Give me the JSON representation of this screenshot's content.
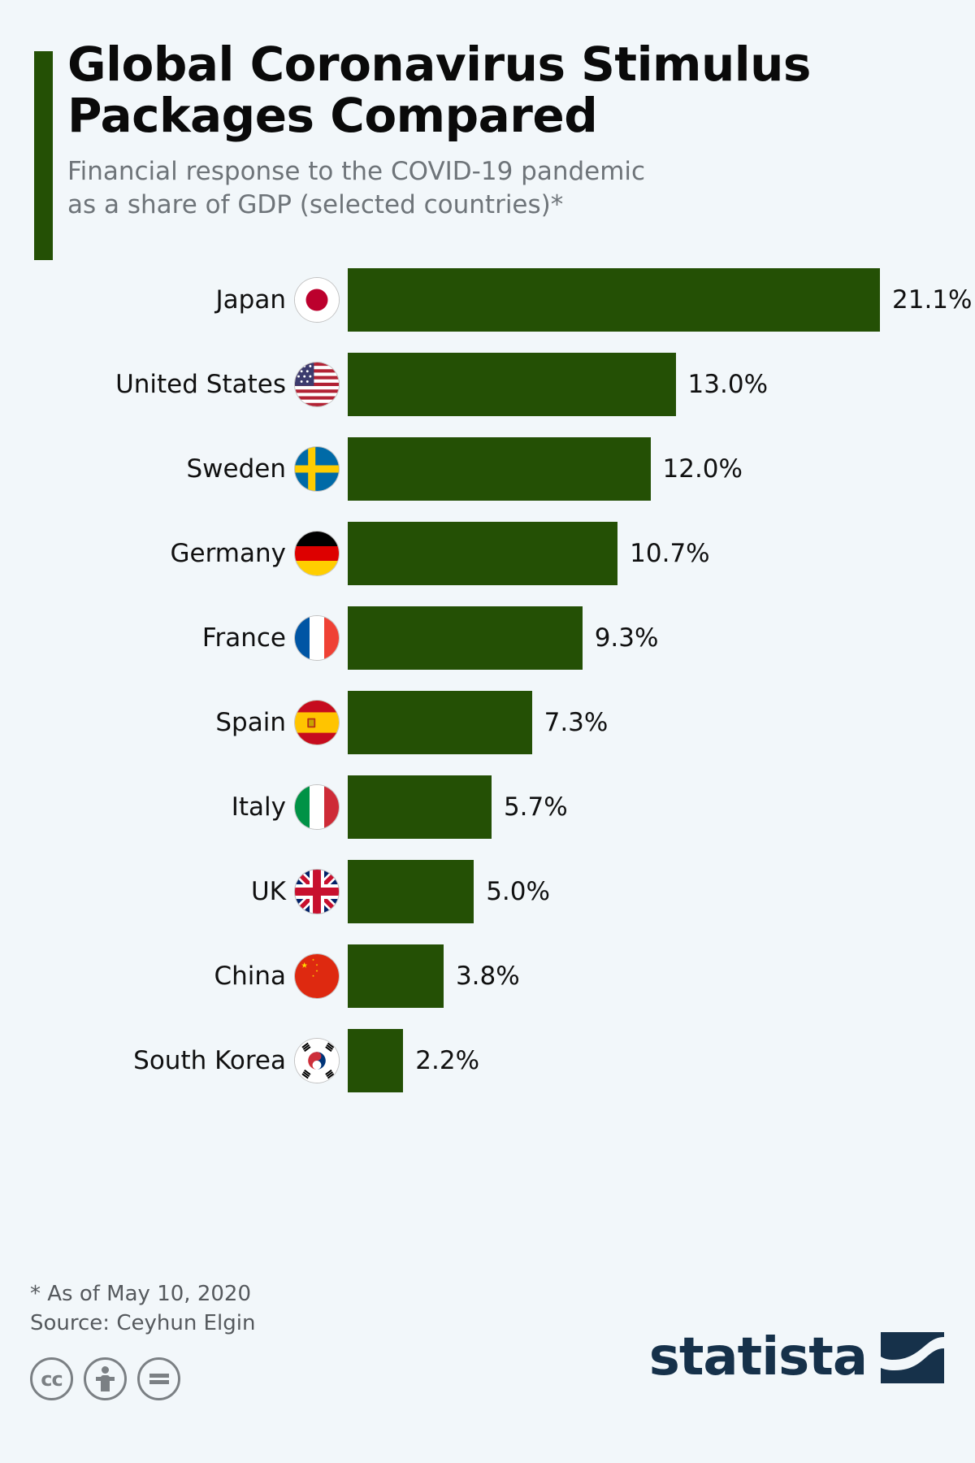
{
  "header": {
    "title": "Global Coronavirus Stimulus Packages Compared",
    "title_line1": "Global Coronavirus Stimulus",
    "title_line2": "Packages Compared",
    "subtitle_line1": "Financial response to the COVID-19 pandemic",
    "subtitle_line2": "as a share of GDP (selected countries)*",
    "accent_color": "#245005"
  },
  "footer": {
    "footnote_line1": "* As of May 10, 2020",
    "footnote_line2": "Source: Ceyhun Elgin",
    "cc_icons": [
      "cc-icon",
      "cc-by-attribution-icon",
      "cc-nd-equals-icon"
    ],
    "cc_label": "cc",
    "brand": "statista",
    "brand_color": "#16314a"
  },
  "chart_data": {
    "type": "bar",
    "orientation": "horizontal",
    "title": "Global Coronavirus Stimulus Packages Compared",
    "subtitle": "Financial response to the COVID-19 pandemic as a share of GDP (selected countries)*",
    "xlabel": "",
    "ylabel": "",
    "unit": "%",
    "xlim": [
      0,
      21.1
    ],
    "grid": false,
    "legend": false,
    "bar_color": "#245005",
    "background_color": "#f2f7fa",
    "source": "Ceyhun Elgin",
    "note": "* As of May 10, 2020",
    "categories": [
      "Japan",
      "United States",
      "Sweden",
      "Germany",
      "France",
      "Spain",
      "Italy",
      "UK",
      "China",
      "South Korea"
    ],
    "values": [
      21.1,
      13.0,
      12.0,
      10.7,
      9.3,
      7.3,
      5.7,
      5.0,
      3.8,
      2.2
    ],
    "value_labels": [
      "21.1%",
      "13.0%",
      "12.0%",
      "10.7%",
      "9.3%",
      "7.3%",
      "5.7%",
      "5.0%",
      "3.8%",
      "2.2%"
    ],
    "rows": [
      {
        "label": "Japan",
        "value": 21.1,
        "value_label": "21.1%",
        "flag": "flag-japan-icon"
      },
      {
        "label": "United States",
        "value": 13.0,
        "value_label": "13.0%",
        "flag": "flag-united-states-icon"
      },
      {
        "label": "Sweden",
        "value": 12.0,
        "value_label": "12.0%",
        "flag": "flag-sweden-icon"
      },
      {
        "label": "Germany",
        "value": 10.7,
        "value_label": "10.7%",
        "flag": "flag-germany-icon"
      },
      {
        "label": "France",
        "value": 9.3,
        "value_label": "9.3%",
        "flag": "flag-france-icon"
      },
      {
        "label": "Spain",
        "value": 7.3,
        "value_label": "7.3%",
        "flag": "flag-spain-icon"
      },
      {
        "label": "Italy",
        "value": 5.7,
        "value_label": "5.7%",
        "flag": "flag-italy-icon"
      },
      {
        "label": "UK",
        "value": 5.0,
        "value_label": "5.0%",
        "flag": "flag-uk-icon"
      },
      {
        "label": "China",
        "value": 3.8,
        "value_label": "3.8%",
        "flag": "flag-china-icon"
      },
      {
        "label": "South Korea",
        "value": 2.2,
        "value_label": "2.2%",
        "flag": "flag-south-korea-icon"
      }
    ]
  }
}
